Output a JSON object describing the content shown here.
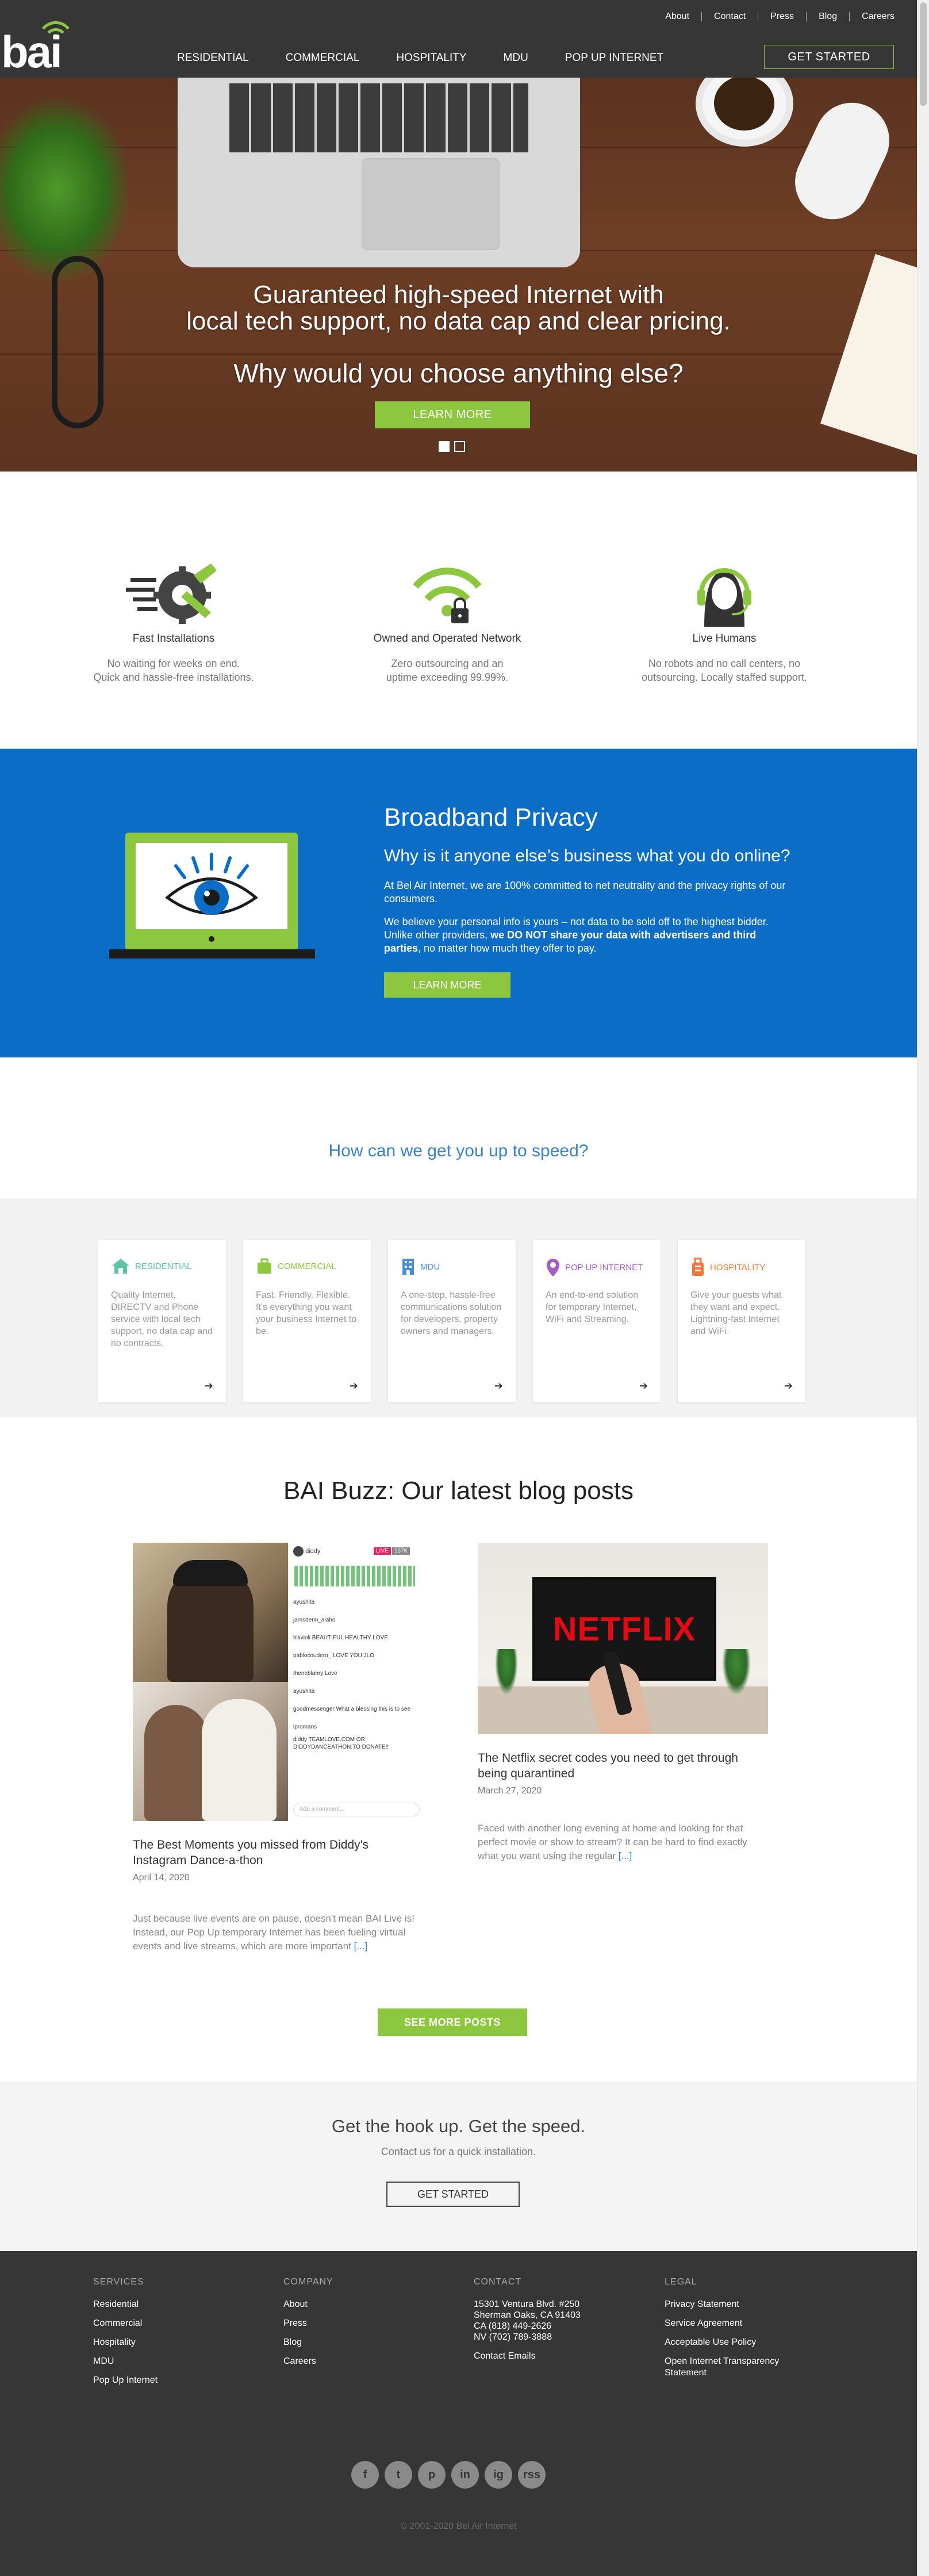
{
  "header": {
    "logo_text": "bai",
    "top_links": [
      "About",
      "Contact",
      "Press",
      "Blog",
      "Careers"
    ],
    "nav": [
      "RESIDENTIAL",
      "COMMERCIAL",
      "HOSPITALITY",
      "MDU",
      "POP UP INTERNET"
    ],
    "cta": "GET STARTED"
  },
  "hero": {
    "line1": "Guaranteed high-speed Internet with",
    "line2": "local tech support, no data cap and clear pricing.",
    "question": "Why would you choose anything else?",
    "button": "LEARN MORE",
    "slides": 2,
    "active_slide": 1
  },
  "features": [
    {
      "title": "Fast Installations",
      "desc1": "No waiting for weeks on end.",
      "desc2": "Quick and hassle-free installations.",
      "icon": "gear-wrench-icon"
    },
    {
      "title": "Owned and Operated Network",
      "desc1": "Zero outsourcing and an",
      "desc2": "uptime exceeding 99.99%.",
      "icon": "wifi-lock-icon"
    },
    {
      "title": "Live Humans",
      "desc1": "No robots and no call centers, no",
      "desc2": "outsourcing. Locally staffed support.",
      "icon": "headset-person-icon"
    }
  ],
  "privacy": {
    "title": "Broadband Privacy",
    "subtitle": "Why is it anyone else’s business what you do online?",
    "p1": "At Bel Air Internet, we are 100% committed to net neutrality and the privacy rights of our consumers.",
    "p2_a": "We believe your personal info is yours – not data to be sold off to the highest bidder. Unlike other providers, ",
    "p2_b": "we DO NOT share your data with advertisers and third parties",
    "p2_c": ", no matter how much they offer to pay.",
    "button": "LEARN MORE"
  },
  "speed": {
    "question": "How can we get you up to speed?",
    "cards": [
      {
        "label": "RESIDENTIAL",
        "color": "#5bc3a6",
        "text": "Quality Internet, DIRECTV and Phone service with local tech support, no data cap and no contracts.",
        "icon": "house-icon"
      },
      {
        "label": "COMMERCIAL",
        "color": "#8dc63f",
        "text": "Fast. Friendly. Flexible. It's everything you want your business Internet to be.",
        "icon": "briefcase-icon"
      },
      {
        "label": "MDU",
        "color": "#4a8fd6",
        "text": "A one-stop, hassle-free communications solution for developers, property owners and managers.",
        "icon": "building-icon"
      },
      {
        "label": "POP UP INTERNET",
        "color": "#a45cc4",
        "text": "An end-to-end solution for temporary Internet, WiFi and Streaming.",
        "icon": "map-pin-wifi-icon"
      },
      {
        "label": "HOSPITALITY",
        "color": "#f07a3c",
        "text": "Give your guests what they want and expect. Lightning-fast Internet and WiFi.",
        "icon": "luggage-icon"
      }
    ]
  },
  "blog": {
    "heading": "BAI Buzz: Our latest blog posts",
    "posts": [
      {
        "title": "The Best Moments you missed from Diddy's Instagram Dance-a-thon",
        "date": "April 14, 2020",
        "excerpt": "Just because live events are on pause, doesn't mean BAI Live is! Instead, our Pop Up temporary Internet has been fueling virtual events and live streams, which are more important ",
        "more": "[...]",
        "comments": [
          "diddy",
          "ayushita",
          "jamsdenn_alaho",
          "blkvioli BEAUTIFUL HEALTHY LOVE",
          "pablocoudero_ LOVE YOU JLO",
          "theneblahry Love",
          "ayushita",
          "goodmessenger What a blessing this is to see",
          "lpromans",
          "diddy TEAMLOVE.COM OR DIDDYDANCEATHON.TO DONATE!!"
        ],
        "live_badge": "LIVE",
        "viewers": "157K",
        "comment_placeholder": "Add a comment..."
      },
      {
        "title": "The Netflix secret codes you need to get through being quarantined",
        "date": "March 27, 2020",
        "excerpt": "Faced with another long evening at home and looking for that perfect movie or show to stream? It can be hard to find exactly what you want using the regular ",
        "more": "[...]",
        "tv_logo": "NETFLIX"
      }
    ],
    "see_more": "SEE MORE POSTS"
  },
  "cta": {
    "heading": "Get the hook up. Get the speed.",
    "sub": "Contact us for a quick installation.",
    "button": "GET STARTED"
  },
  "footer": {
    "services_heading": "SERVICES",
    "services": [
      "Residential",
      "Commercial",
      "Hospitality",
      "MDU",
      "Pop Up Internet"
    ],
    "company_heading": "COMPANY",
    "company": [
      "About",
      "Press",
      "Blog",
      "Careers"
    ],
    "contact_heading": "CONTACT",
    "contact": [
      "15301 Ventura Blvd. #250",
      "Sherman Oaks, CA 91403",
      "CA (818) 449-2626",
      "NV (702) 789-3888"
    ],
    "contact_emails": "Contact Emails",
    "legal_heading": "LEGAL",
    "legal": [
      "Privacy Statement",
      "Service Agreement",
      "Acceptable Use Policy",
      "Open Internet Transparency Statement"
    ],
    "social": [
      "f",
      "t",
      "p",
      "in",
      "ig",
      "rss"
    ],
    "copyright": "© 2001-2020 Bel Air Internet"
  },
  "colors": {
    "green": "#8dc63f",
    "blue": "#0b6dc6",
    "dark": "#363636"
  }
}
